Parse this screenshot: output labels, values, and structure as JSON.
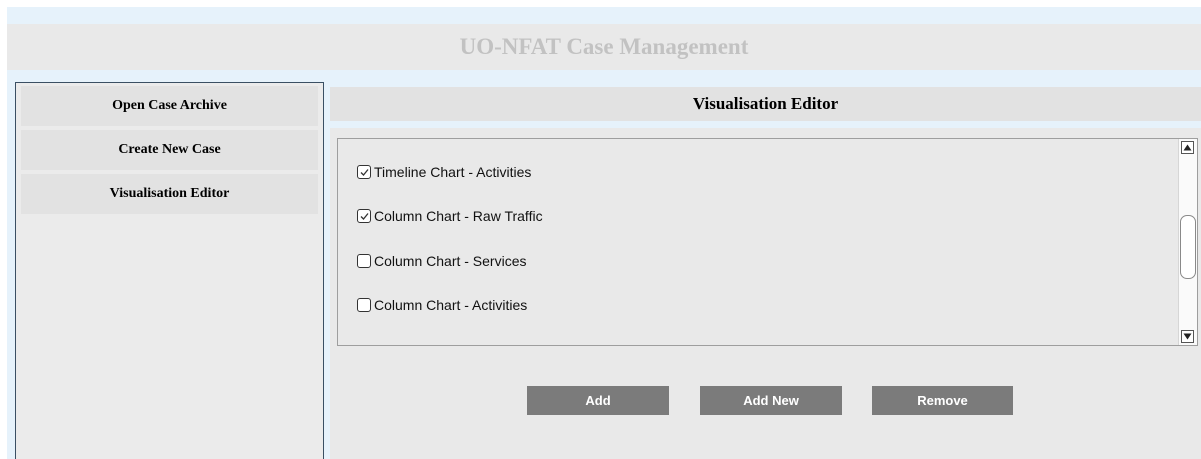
{
  "app": {
    "title": "UO-NFAT Case Management"
  },
  "sidebar": {
    "items": [
      {
        "label": "Open Case Archive"
      },
      {
        "label": "Create New Case"
      },
      {
        "label": "Visualisation Editor"
      }
    ]
  },
  "main": {
    "header": "Visualisation Editor",
    "list": [
      {
        "label": "Timeline Chart - Activities",
        "checked": true
      },
      {
        "label": "Column Chart - Raw Traffic",
        "checked": true
      },
      {
        "label": "Column Chart - Services",
        "checked": false
      },
      {
        "label": "Column Chart - Activities",
        "checked": false
      }
    ],
    "buttons": {
      "add": "Add",
      "add_new": "Add New",
      "remove": "Remove"
    }
  },
  "colors": {
    "frame_bg": "#e6f2fb",
    "title_text": "#c2c2c2",
    "button_bg": "#7b7b7b",
    "sidebar_border": "#3a4f63"
  }
}
